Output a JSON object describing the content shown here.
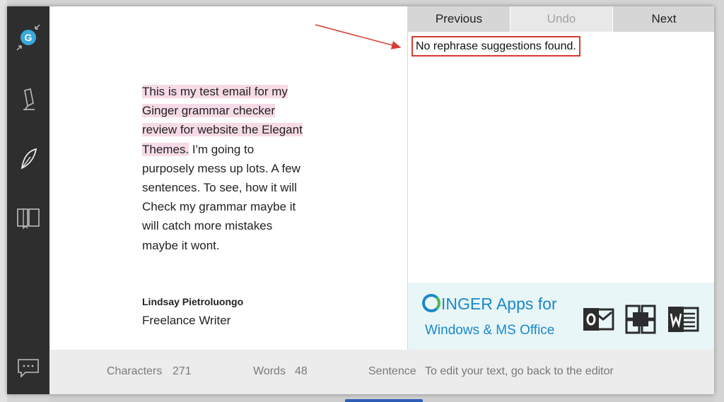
{
  "editor": {
    "highlighted_text": "This is my test email for my Ginger grammar checker review for website the Elegant Themes.",
    "plain_text": " I'm going to purposely mess up lots. A few sentences. To see, how it will Check my grammar maybe it will catch more mistakes maybe it wont.",
    "signature_name": "Lindsay Pietroluongo",
    "signature_title": "Freelance Writer"
  },
  "panel": {
    "tabs": [
      {
        "label": "Previous",
        "enabled": true
      },
      {
        "label": "Undo",
        "enabled": false
      },
      {
        "label": "Next",
        "enabled": true
      }
    ],
    "message": "No rephrase suggestions found."
  },
  "ad": {
    "brand": "INGER",
    "brand_suffix": " Apps for",
    "line2": "Windows & MS Office",
    "products": [
      "outlook-icon",
      "windows-icon",
      "word-icon"
    ]
  },
  "status": {
    "characters_label": "Characters",
    "characters_value": "271",
    "words_label": "Words",
    "words_value": "48",
    "sentence_label": "Sentence",
    "hint": "To edit your text, go back to the editor"
  },
  "sidebar": {
    "icons": [
      "ginger-logo-icon",
      "pen-icon",
      "feather-icon",
      "book-icon",
      "chat-icon"
    ]
  },
  "colors": {
    "sidebar": "#2e2e2e",
    "highlight": "#f6dbe6",
    "annotation": "#d63b2f",
    "brand": "#1a88c9"
  }
}
